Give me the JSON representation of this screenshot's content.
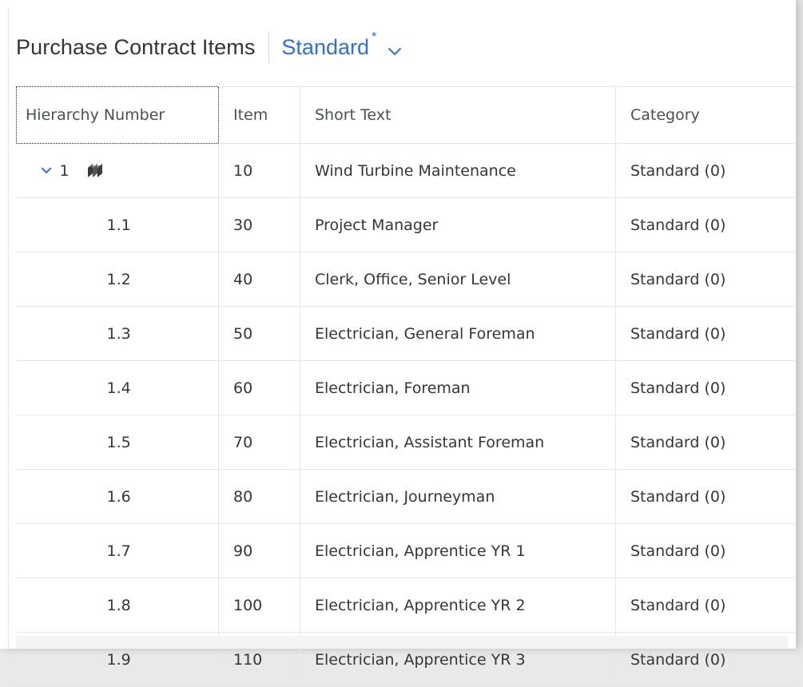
{
  "toolbar": {
    "title": "Purchase Contract Items",
    "variant_label": "Standard",
    "variant_modified_marker": "*"
  },
  "colors": {
    "accent": "#2f6fd6",
    "text": "#32363a",
    "border": "#e5e5e5"
  },
  "table": {
    "columns": [
      "Hierarchy Number",
      "Item",
      "Short Text",
      "Category"
    ],
    "parent": {
      "hierarchy": "1",
      "item": "10",
      "short_text": "Wind Turbine Maintenance",
      "category": "Standard (0)",
      "expanded": true,
      "icon": "service-hierarchy-icon"
    },
    "rows": [
      {
        "hierarchy": "1.1",
        "item": "30",
        "short_text": "Project Manager",
        "category": "Standard (0)"
      },
      {
        "hierarchy": "1.2",
        "item": "40",
        "short_text": "Clerk, Office, Senior Level",
        "category": "Standard (0)"
      },
      {
        "hierarchy": "1.3",
        "item": "50",
        "short_text": "Electrician, General Foreman",
        "category": "Standard (0)"
      },
      {
        "hierarchy": "1.4",
        "item": "60",
        "short_text": "Electrician, Foreman",
        "category": "Standard (0)"
      },
      {
        "hierarchy": "1.5",
        "item": "70",
        "short_text": "Electrician, Assistant Foreman",
        "category": "Standard (0)"
      },
      {
        "hierarchy": "1.6",
        "item": "80",
        "short_text": "Electrician, Journeyman",
        "category": "Standard (0)"
      },
      {
        "hierarchy": "1.7",
        "item": "90",
        "short_text": "Electrician, Apprentice YR 1",
        "category": "Standard (0)"
      },
      {
        "hierarchy": "1.8",
        "item": "100",
        "short_text": "Electrician, Apprentice YR 2",
        "category": "Standard (0)"
      },
      {
        "hierarchy": "1.9",
        "item": "110",
        "short_text": "Electrician, Apprentice YR 3",
        "category": "Standard (0)"
      }
    ]
  }
}
